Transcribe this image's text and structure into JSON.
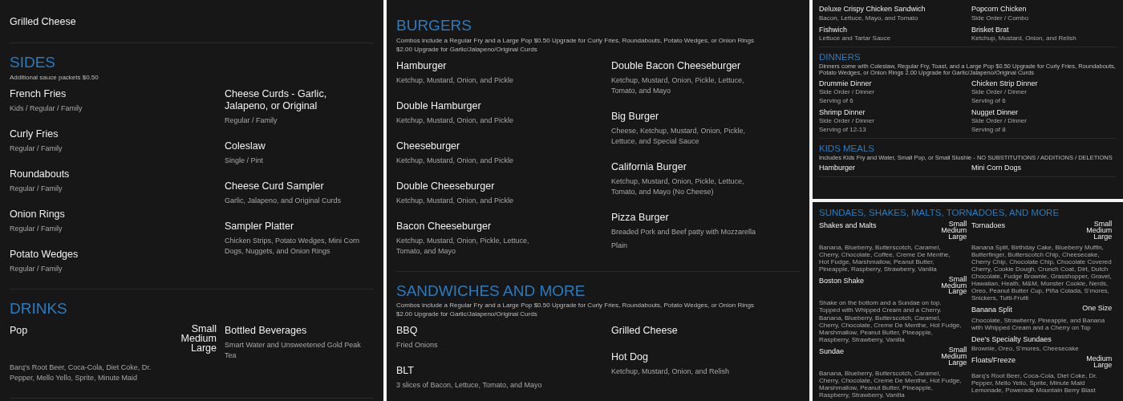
{
  "panels": [
    {
      "kind": "large",
      "sections": [
        {
          "columns": [
            [
              {
                "name": "Grilled Cheese"
              }
            ],
            []
          ]
        },
        {
          "title": "SIDES",
          "notes": [
            "Additional sauce packets $0.50"
          ],
          "columns": [
            [
              {
                "name": "French Fries",
                "details": [
                  "Kids / Regular / Family"
                ]
              },
              {
                "name": "Curly Fries",
                "details": [
                  "Regular / Family"
                ]
              },
              {
                "name": "Roundabouts",
                "details": [
                  "Regular / Family"
                ]
              },
              {
                "name": "Onion Rings",
                "details": [
                  "Regular / Family"
                ]
              },
              {
                "name": "Potato Wedges",
                "details": [
                  "Regular / Family"
                ]
              }
            ],
            [
              {
                "name": "Cheese Curds - Garlic, Jalapeno, or Original",
                "details": [
                  "Regular / Family"
                ]
              },
              {
                "name": "Coleslaw",
                "details": [
                  "Single / Pint"
                ]
              },
              {
                "name": "Cheese Curd Sampler",
                "details": [
                  "Garlic, Jalapeno, and Original Curds"
                ]
              },
              {
                "name": "Sampler Platter",
                "details": [
                  "Chicken Strips, Potato Wedges, Mini Corn Dogs, Nuggets, and Onion Rings"
                ]
              }
            ]
          ]
        },
        {
          "title": "DRINKS",
          "columns": [
            [
              {
                "name": "Pop",
                "sizes": [
                  "Small",
                  "Medium",
                  "Large"
                ],
                "details": [
                  "Barq's Root Beer, Coca-Cola, Diet Coke, Dr. Pepper, Mello Yello, Sprite, Minute Maid"
                ]
              }
            ],
            [
              {
                "name": "Bottled Beverages",
                "details": [
                  "Smart Water and Unsweetened Gold Peak Tea"
                ]
              }
            ]
          ]
        }
      ]
    },
    {
      "kind": "large",
      "sections": [
        {
          "title": "BURGERS",
          "notes": [
            "Combos include a Regular Fry and a Large Pop $0.50 Upgrade for Curly Fries, Roundabouts, Potato Wedges, or Onion Rings",
            "$2.00 Upgrade for Garlic/Jalapeno/Original Curds"
          ],
          "columns": [
            [
              {
                "name": "Hamburger",
                "details": [
                  "Ketchup, Mustard, Onion, and Pickle"
                ]
              },
              {
                "name": "Double Hamburger",
                "details": [
                  "Ketchup, Mustard, Onion, and Pickle"
                ]
              },
              {
                "name": "Cheeseburger",
                "details": [
                  "Ketchup, Mustard, Onion, and Pickle"
                ]
              },
              {
                "name": "Double Cheeseburger",
                "details": [
                  "Ketchup, Mustard, Onion, and Pickle"
                ]
              },
              {
                "name": "Bacon Cheeseburger",
                "details": [
                  "Ketchup, Mustard, Onion, Pickle, Lettuce, Tomato, and Mayo"
                ]
              }
            ],
            [
              {
                "name": "Double Bacon Cheeseburger",
                "details": [
                  "Ketchup, Mustard, Onion, Pickle, Lettuce, Tomato, and Mayo"
                ]
              },
              {
                "name": "Big Burger",
                "details": [
                  "Cheese, Ketchup, Mustard, Onion, Pickle, Lettuce, and Special Sauce"
                ]
              },
              {
                "name": "California Burger",
                "details": [
                  "Ketchup, Mustard, Onion, Pickle, Lettuce, Tomato, and Mayo (No Cheese)"
                ]
              },
              {
                "name": "Pizza Burger",
                "details": [
                  "Breaded Pork and Beef patty with Mozzarella",
                  "Plain"
                ]
              }
            ]
          ]
        },
        {
          "title": "SANDWICHES AND MORE",
          "notes": [
            "Combos include a Regular Fry and a Large Pop $0.50 Upgrade for Curly Fries, Roundabouts, Potato Wedges, or Onion Rings",
            "$2.00 Upgrade for Garlic/Jalapeno/Original Curds"
          ],
          "columns": [
            [
              {
                "name": "BBQ",
                "details": [
                  "Fried Onions"
                ]
              },
              {
                "name": "BLT",
                "details": [
                  "3 slices of Bacon, Lettuce, Tomato, and Mayo"
                ]
              }
            ],
            [
              {
                "name": "Grilled Cheese"
              },
              {
                "name": "Hot Dog",
                "details": [
                  "Ketchup, Mustard, Onion, and Relish"
                ]
              }
            ]
          ]
        }
      ]
    },
    {
      "kind": "small",
      "sections": [
        {
          "columns": [
            [
              {
                "name": "Deluxe Crispy Chicken Sandwich",
                "details": [
                  "Bacon, Lettuce, Mayo, and Tomato"
                ]
              },
              {
                "name": "Fishwich",
                "details": [
                  "Lettuce and Tartar Sauce"
                ]
              }
            ],
            [
              {
                "name": "Popcorn Chicken",
                "details": [
                  "Side Order / Combo"
                ]
              },
              {
                "name": "Brisket Brat",
                "details": [
                  "Ketchup, Mustard, Onion, and Relish"
                ]
              }
            ]
          ]
        },
        {
          "title": "DINNERS",
          "notes": [
            "Dinners come with Coleslaw, Regular Fry, Toast, and a Large Pop $0.50 Upgrade for Curly Fries, Roundabouts, Potato Wedges, or Onion Rings 2.00 Upgrade for Garlic/Jalapeno/Original Curds"
          ],
          "columns": [
            [
              {
                "name": "Drummie Dinner",
                "details": [
                  "Side Order / Dinner",
                  "Serving of 6"
                ]
              },
              {
                "name": "Shrimp Dinner",
                "details": [
                  "Side Order / Dinner",
                  "Serving of 12-13"
                ]
              }
            ],
            [
              {
                "name": "Chicken Strip Dinner",
                "details": [
                  "Side Order / Dinner",
                  "Serving of 6"
                ]
              },
              {
                "name": "Nugget Dinner",
                "details": [
                  "Side Order / Dinner",
                  "Serving of 8"
                ]
              }
            ]
          ]
        },
        {
          "title": "KIDS MEALS",
          "notes": [
            "Includes Kids Fry and Water, Small Pop, or Small Slushie - NO SUBSTITUTIONS / ADDITIONS / DELETIONS"
          ],
          "columns": [
            [
              {
                "name": "Hamburger"
              }
            ],
            [
              {
                "name": "Mini Corn Dogs"
              }
            ]
          ]
        }
      ]
    },
    {
      "kind": "small",
      "sections": [
        {
          "title": "SUNDAES, SHAKES, MALTS, TORNADOES, AND MORE",
          "columns": [
            [
              {
                "name": "Shakes and Malts",
                "sizes": [
                  "Small",
                  "Medium",
                  "Large"
                ],
                "details": [
                  "Banana, Blueberry, Butterscotch, Caramel, Cherry, Chocolate, Coffee, Creme De Menthe, Hot Fudge, Marshmallow, Peanut Butter, Pineapple, Raspberry, Strawberry, Vanilla"
                ]
              },
              {
                "name": "Boston Shake",
                "sizes": [
                  "Small",
                  "Medium",
                  "Large"
                ],
                "details": [
                  "Shake on the bottom and a Sundae on top. Topped with Whipped Cream and a Cherry.",
                  "Banana, Blueberry, Butterscotch, Caramel, Cherry, Chocolate, Creme De Menthe, Hot Fudge, Marshmallow, Peanut Butter, Pineapple, Raspberry, Strawberry, Vanilla"
                ]
              },
              {
                "name": "Sundae",
                "sizes": [
                  "Small",
                  "Medium",
                  "Large"
                ],
                "details": [
                  "Banana, Blueberry, Butterscotch, Caramel, Cherry, Chocolate, Creme De Menthe, Hot Fudge, Marshmallow, Peanut Butter, Pineapple, Raspberry, Strawberry, Vanilla"
                ]
              }
            ],
            [
              {
                "name": "Tornadoes",
                "sizes": [
                  "Small",
                  "Medium",
                  "Large"
                ],
                "details": [
                  "Banana Split, Birthday Cake, Blueberry Muffin, Butterfinger, Butterscotch Chip, Cheesecake, Cherry Chip, Chocolate Chip, Chocolate Covered Cherry, Cookie Dough, Crunch Coat, Dirt, Dutch Chocolate, Fudge Brownie, Grasshopper, Gravel, Hawaiian, Heath, M&M, Monster Cookie, Nerds, Oreo, Peanut Butter Cup, Piña Colada, S'mores, Snickers, Tutti-Frutti"
                ]
              },
              {
                "name": "Banana Split",
                "sizes": [
                  "One Size"
                ],
                "details": [
                  "Chocolate, Strawberry, Pineapple, and Banana with Whipped Cream and a Cherry on Top"
                ]
              },
              {
                "name": "Dee's Specialty Sundaes",
                "details": [
                  "Brownie, Oreo, S'mores, Cheesecake"
                ]
              },
              {
                "name": "Floats/Freeze",
                "sizes": [
                  "Medium",
                  "Large"
                ],
                "details": [
                  "Barq's Root Beer, Coca-Cola, Diet Coke, Dr. Pepper, Mello Yello, Sprite, Minute Maid Lemonade, Powerade Mountain Berry Blast"
                ]
              }
            ]
          ]
        }
      ]
    }
  ]
}
